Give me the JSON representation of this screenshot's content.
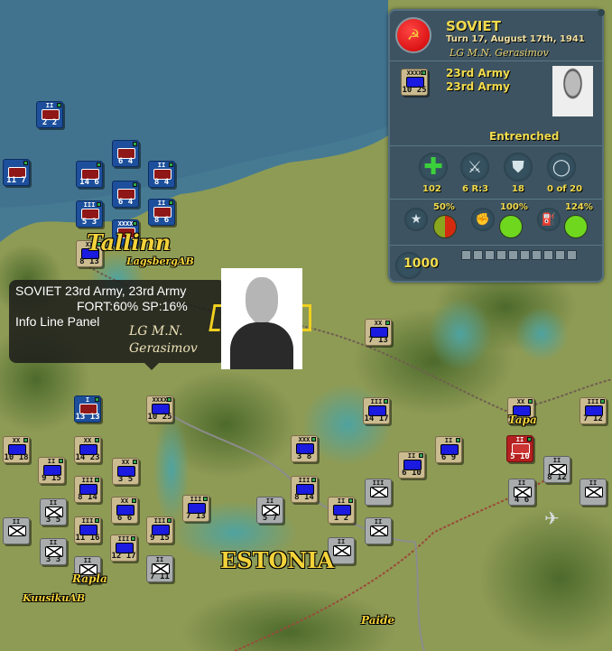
{
  "info_panel": {
    "side": "SOVIET",
    "turn": "Turn 17, August 17th, 1941",
    "leader": "LG M.N. Gerasimov",
    "unit_name_1": "23rd Army",
    "unit_name_2": "23rd Army",
    "unit_counter": {
      "size": "XXXX",
      "values": "10 25"
    },
    "status": "Entrenched",
    "stats": [
      {
        "icon": "plus-icon",
        "value": "102"
      },
      {
        "icon": "crossed-swords-icon",
        "value": "6 R:3"
      },
      {
        "icon": "shield-icon",
        "value": "18"
      },
      {
        "icon": "ring-icon",
        "value": "0 of 20"
      }
    ],
    "gauges": [
      {
        "icon": "star-icon",
        "label": "50%",
        "percent": 50,
        "color": "#d42a10"
      },
      {
        "icon": "fist-icon",
        "label": "100%",
        "percent": 100,
        "color": "#6fd81e"
      },
      {
        "icon": "supply-icon",
        "label": "124%",
        "percent": 124,
        "color": "#6fd81e"
      }
    ],
    "points": "1000",
    "pip_count": 10
  },
  "tooltip": {
    "line1": "SOVIET 23rd Army, 23rd Army",
    "line2": "FORT:60% SP:16%",
    "line3": "Info Line Panel",
    "leader_line1": "LG M.N.",
    "leader_line2": "Gerasimov"
  },
  "places": [
    {
      "name": "Tallinn"
    },
    {
      "name": "LagsbergAB"
    },
    {
      "name": "Rapla"
    },
    {
      "name": "KuusikuAB"
    },
    {
      "name": "ESTONIA"
    },
    {
      "name": "Tapa"
    },
    {
      "name": "Paide"
    }
  ],
  "counters": [
    {
      "size": "II",
      "values": "2 2",
      "style": "navy"
    },
    {
      "size": "",
      "values": "11 7",
      "style": "navy"
    },
    {
      "size": "",
      "values": "14 6",
      "style": "navy"
    },
    {
      "size": "",
      "values": "6 4",
      "style": "navy"
    },
    {
      "size": "",
      "values": "6 4",
      "style": "navy"
    },
    {
      "size": "II",
      "values": "8 4",
      "style": "navy"
    },
    {
      "size": "III",
      "values": "5 3",
      "style": "navy"
    },
    {
      "size": "II",
      "values": "8 6",
      "style": "navy"
    },
    {
      "size": "XXXX",
      "values": "",
      "style": "navy"
    },
    {
      "size": "XX",
      "values": "8 13",
      "style": "tan"
    },
    {
      "size": "I",
      "values": "13 13",
      "style": "navy"
    },
    {
      "size": "XXXX",
      "values": "10 25",
      "style": "tan"
    },
    {
      "size": "XX",
      "values": "10 18",
      "style": "tan"
    },
    {
      "size": "XX",
      "values": "14 23",
      "style": "tan"
    },
    {
      "size": "II",
      "values": "9 15",
      "style": "tan"
    },
    {
      "size": "XX",
      "values": "3 5",
      "style": "tan"
    },
    {
      "size": "III",
      "values": "8 14",
      "style": "tan"
    },
    {
      "size": "II",
      "values": "3 5",
      "style": "gray"
    },
    {
      "size": "II",
      "values": "",
      "style": "gray"
    },
    {
      "size": "III",
      "values": "11 16",
      "style": "tan"
    },
    {
      "size": "XX",
      "values": "6 6",
      "style": "tan"
    },
    {
      "size": "III",
      "values": "9 15",
      "style": "tan"
    },
    {
      "size": "III",
      "values": "7 13",
      "style": "tan"
    },
    {
      "size": "II",
      "values": "3 3",
      "style": "gray"
    },
    {
      "size": "II",
      "values": "",
      "style": "gray"
    },
    {
      "size": "III",
      "values": "12 17",
      "style": "tan"
    },
    {
      "size": "II",
      "values": "7 11",
      "style": "gray"
    },
    {
      "size": "XXX",
      "values": "3 8",
      "style": "tan"
    },
    {
      "size": "III",
      "values": "8 14",
      "style": "tan"
    },
    {
      "size": "II",
      "values": "5 7",
      "style": "gray"
    },
    {
      "size": "II",
      "values": "1 2",
      "style": "tan"
    },
    {
      "size": "III",
      "values": "",
      "style": "gray"
    },
    {
      "size": "II",
      "values": "",
      "style": "gray"
    },
    {
      "size": "II",
      "values": "",
      "style": "gray"
    },
    {
      "size": "XX",
      "values": "7 13",
      "style": "tan"
    },
    {
      "size": "III",
      "values": "14 17",
      "style": "tan"
    },
    {
      "size": "II",
      "values": "6 10",
      "style": "tan"
    },
    {
      "size": "II",
      "values": "6 9",
      "style": "tan"
    },
    {
      "size": "XX",
      "values": "",
      "style": "tan"
    },
    {
      "size": "III",
      "values": "7 12",
      "style": "tan"
    },
    {
      "size": "II",
      "values": "5 10",
      "style": "red"
    },
    {
      "size": "II",
      "values": "8 12",
      "style": "gray"
    },
    {
      "size": "II",
      "values": "4 6",
      "style": "gray"
    },
    {
      "size": "II",
      "values": "",
      "style": "gray"
    }
  ]
}
